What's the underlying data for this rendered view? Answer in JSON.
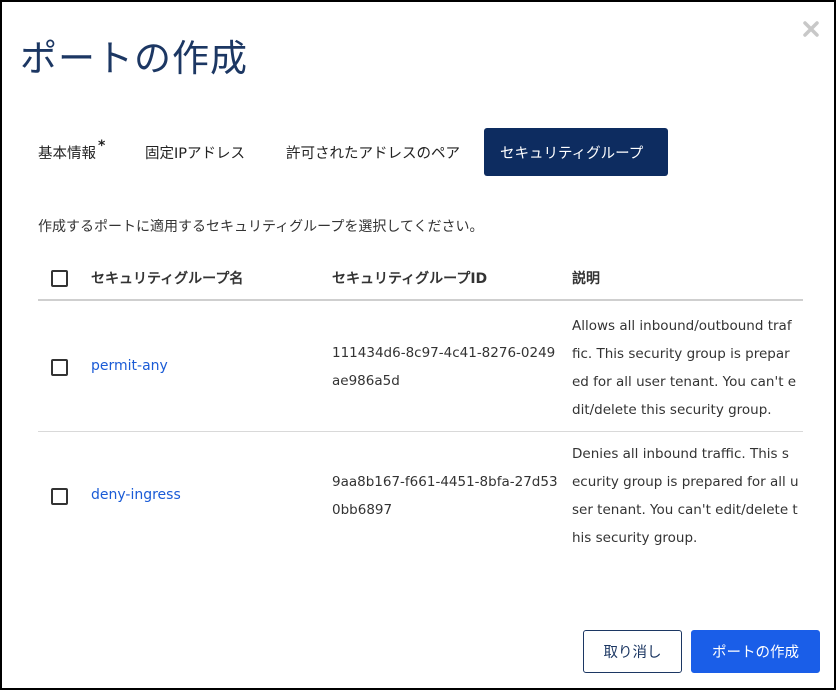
{
  "dialog": {
    "title": "ポートの作成",
    "close_icon": "close-icon"
  },
  "tabs": [
    {
      "label": "基本情報",
      "required_marker": "*",
      "active": false
    },
    {
      "label": "固定IPアドレス",
      "active": false
    },
    {
      "label": "許可されたアドレスのペア",
      "active": false
    },
    {
      "label": "セキュリティグループ",
      "active": true
    }
  ],
  "description": "作成するポートに適用するセキュリティグループを選択してください。",
  "table": {
    "columns": [
      "セキュリティグループ名",
      "セキュリティグループID",
      "説明"
    ],
    "rows": [
      {
        "name": "permit-any",
        "id": "111434d6-8c97-4c41-8276-0249\nae986a5d",
        "description": "Allows all inbound/outbound traf\nfic. This security group is prepar\ned for all user tenant. You can't e\ndit/delete this security group."
      },
      {
        "name": "deny-ingress",
        "id": "9aa8b167-f661-4451-8bfa-27d53\n0bb6897",
        "description": "Denies all inbound traffic. This s\necurity group is prepared for all u\nser tenant. You can't edit/delete t\nhis security group."
      }
    ]
  },
  "footer": {
    "cancel_label": "取り消し",
    "submit_label": "ポートの作成"
  },
  "colors": {
    "title": "#1c3763",
    "active_tab": "#0d2c60",
    "link": "#1a5bd6",
    "primary_button": "#1a5ee8"
  }
}
